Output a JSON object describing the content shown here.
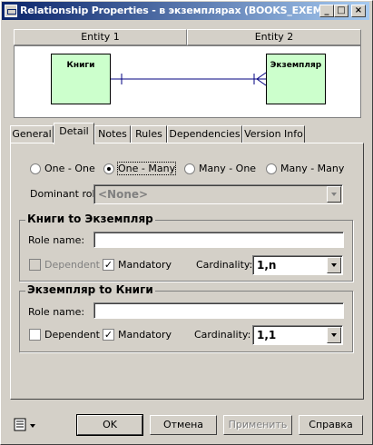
{
  "window": {
    "title": "Relationship Properties - в экземплярах (BOOKS_EXEMPL)"
  },
  "diagram": {
    "entity1_header": "Entity 1",
    "entity2_header": "Entity 2",
    "entity1_name": "Книги",
    "entity2_name": "Экземпляр"
  },
  "tabs": [
    "General",
    "Detail",
    "Notes",
    "Rules",
    "Dependencies",
    "Version Info"
  ],
  "active_tab": "Detail",
  "cardinality_type": {
    "options": [
      "One - One",
      "One - Many",
      "Many - One",
      "Many - Many"
    ],
    "selected": "One - Many"
  },
  "dominant_role": {
    "label": "Dominant role:",
    "value": "<None>"
  },
  "group1": {
    "title": "Книги to Экземпляр",
    "role_label": "Role name:",
    "role_value": "",
    "dependent_label": "Dependent",
    "dependent_checked": false,
    "mandatory_label": "Mandatory",
    "mandatory_checked": true,
    "cardinality_label": "Cardinality:",
    "cardinality_value": "1,n"
  },
  "group2": {
    "title": "Экземпляр to Книги",
    "role_label": "Role name:",
    "role_value": "",
    "dependent_label": "Dependent",
    "dependent_checked": false,
    "mandatory_label": "Mandatory",
    "mandatory_checked": true,
    "cardinality_label": "Cardinality:",
    "cardinality_value": "1,1"
  },
  "buttons": {
    "ok": "OK",
    "cancel": "Отмена",
    "apply": "Применить",
    "help": "Справка"
  },
  "icons": {
    "menu": "list-menu-icon",
    "window": "relationship-icon"
  }
}
